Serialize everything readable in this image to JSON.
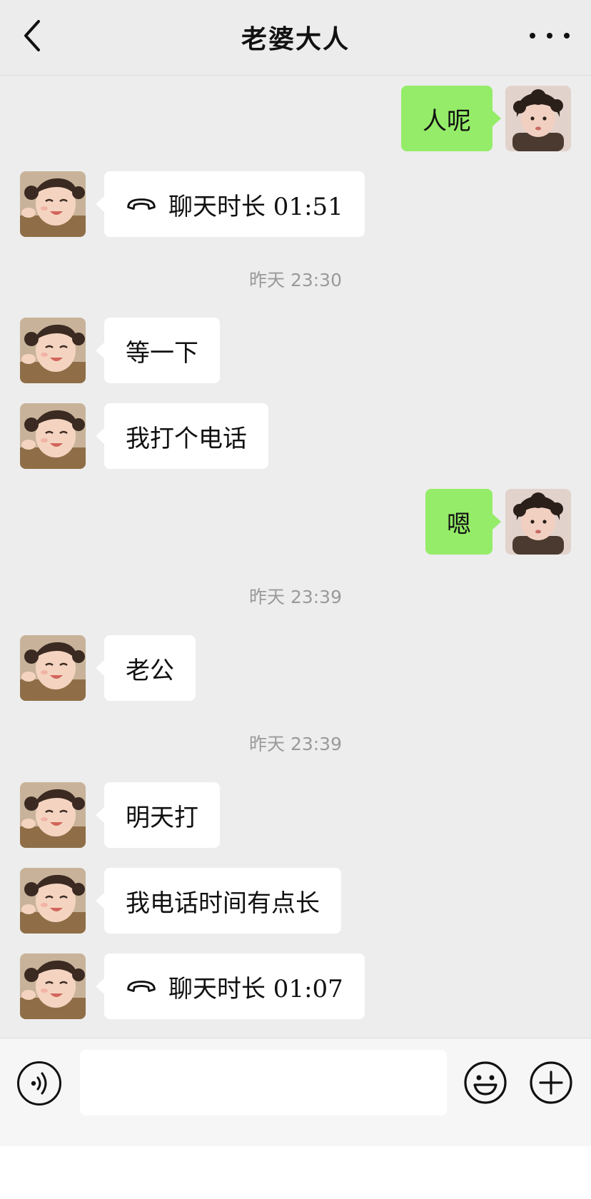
{
  "header": {
    "title": "老婆大人"
  },
  "messages": [
    {
      "text": "人呢"
    },
    {
      "text": "聊天时长 01:51"
    },
    {
      "time": "昨天 23:30"
    },
    {
      "text": "等一下"
    },
    {
      "text": "我打个电话"
    },
    {
      "text": "嗯"
    },
    {
      "time": "昨天 23:39"
    },
    {
      "text": "老公"
    },
    {
      "time": "昨天 23:39"
    },
    {
      "text": "明天打"
    },
    {
      "text": "我电话时间有点长"
    },
    {
      "text": "聊天时长 01:07"
    }
  ],
  "input": {
    "value": "",
    "placeholder": ""
  },
  "colors": {
    "nav_bg": "#ececec",
    "chat_bg": "#ededed",
    "outgoing_bubble": "#95ec69",
    "incoming_bubble": "#ffffff",
    "timestamp": "#9a9a9a"
  },
  "icons": [
    "back-chevron-icon",
    "more-icon",
    "call-ended-icon",
    "voice-icon",
    "emoji-icon",
    "plus-icon"
  ]
}
